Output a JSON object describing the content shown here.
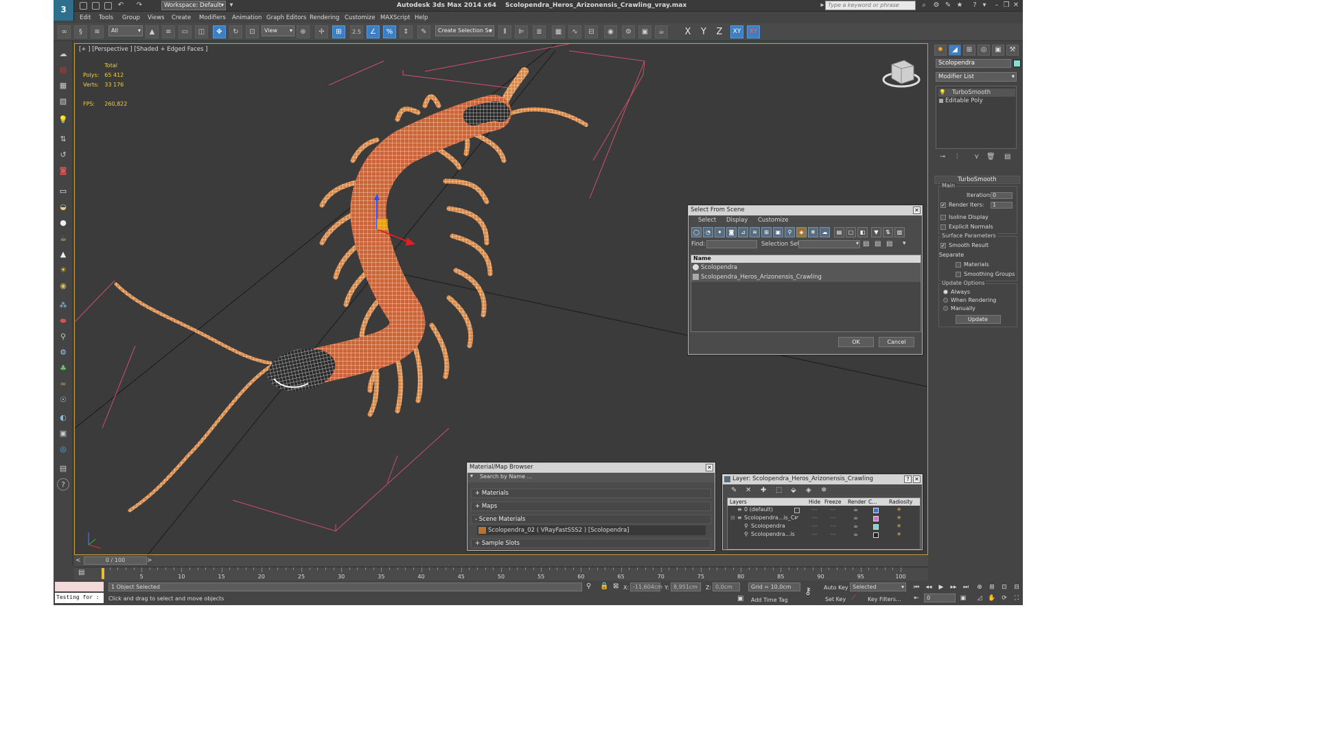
{
  "window": {
    "app_title": "Autodesk 3ds Max  2014 x64",
    "file_name": "Scolopendra_Heros_Arizonensis_Crawling_vray.max",
    "workspace": "Workspace: Default",
    "search_placeholder": "Type a keyword or phrase"
  },
  "menu": [
    "Edit",
    "Tools",
    "Group",
    "Views",
    "Create",
    "Modifiers",
    "Animation",
    "Graph Editors",
    "Rendering",
    "Customize",
    "MAXScript",
    "Help"
  ],
  "toolbar": {
    "filter_select": "All",
    "ref_coord": "View",
    "snap_value": "2.5",
    "selection_set_placeholder": "Create Selection Se",
    "axes": [
      "X",
      "Y",
      "Z",
      "XY"
    ],
    "axis_extra": "XY"
  },
  "viewport": {
    "label": "[+ ] [Perspective ] [Shaded + Edged Faces ]",
    "stats": {
      "total_label": "Total",
      "polys_label": "Polys:",
      "polys_value": "65 412",
      "verts_label": "Verts:",
      "verts_value": "33 176",
      "fps_label": "FPS:",
      "fps_value": "260,822"
    }
  },
  "command_panel": {
    "object_name": "Scolopendra",
    "object_color": "#7de3d4",
    "modifier_list": "Modifier List",
    "stack": [
      "TurboSmooth",
      "Editable Poly"
    ],
    "turbosmooth": {
      "title": "TurboSmooth",
      "main_group": "Main",
      "iterations_label": "Iterations:",
      "iterations_value": "0",
      "render_iters_label": "Render Iters:",
      "render_iters_value": "1",
      "render_iters_checked": true,
      "isoline_label": "Isoline Display",
      "explicit_normals_label": "Explicit Normals",
      "surface_group": "Surface Parameters",
      "smooth_result_label": "Smooth Result",
      "separate_label": "Separate",
      "materials_label": "Materials",
      "smoothing_groups_label": "Smoothing Groups",
      "update_group": "Update Options",
      "always_label": "Always",
      "when_rendering_label": "When Rendering",
      "manually_label": "Manually",
      "update_button": "Update"
    }
  },
  "select_from_scene": {
    "title": "Select From Scene",
    "tabs": [
      "Select",
      "Display",
      "Customize"
    ],
    "find_label": "Find:",
    "selection_set_label": "Selection Set:",
    "column_name": "Name",
    "items": [
      "Scolopendra",
      "Scolopendra_Heros_Arizonensis_Crawling"
    ],
    "ok_label": "OK",
    "cancel_label": "Cancel"
  },
  "material_browser": {
    "title": "Material/Map Browser",
    "search_placeholder": "Search by Name ...",
    "sections": [
      "+ Materials",
      "+ Maps",
      "- Scene Materials"
    ],
    "scene_material": "Scolopendra_02  ( VRayFastSSS2 ) [Scolopendra]",
    "sample_slots": "+ Sample Slots"
  },
  "layer_window": {
    "title": "Layer: Scolopendra_Heros_Arizonensis_Crawling",
    "help": "?",
    "columns": [
      "Layers",
      "Hide",
      "Freeze",
      "Render",
      "C...",
      "Radiosity"
    ],
    "rows": [
      {
        "name": "0 (default)",
        "color": "#3f6fd8"
      },
      {
        "name": "Scolopendra...is_Cr",
        "color": "#d86fd8"
      },
      {
        "name": "Scolopendra",
        "color": "#6fd8d0"
      },
      {
        "name": "Scolopendra...is",
        "color": "#222222"
      }
    ]
  },
  "timeline": {
    "frame_display": "0 / 100",
    "ticks": [
      "0",
      "5",
      "10",
      "15",
      "20",
      "25",
      "30",
      "35",
      "40",
      "45",
      "50",
      "55",
      "60",
      "65",
      "70",
      "75",
      "80",
      "85",
      "90",
      "95",
      "100"
    ]
  },
  "status": {
    "script_listener": "Testing for :",
    "selected_text": "1 Object Selected",
    "prompt_text": "Click and drag to select and move objects",
    "x_label": "X:",
    "x_value": "-11,604cm",
    "y_label": "Y:",
    "y_value": "8,951cm",
    "z_label": "Z:",
    "z_value": "0,0cm",
    "grid_text": "Grid = 10,0cm",
    "add_time_tag": "Add Time Tag",
    "auto_key": "Auto Key",
    "set_key": "Set Key",
    "selected_dropdown": "Selected",
    "key_filters": "Key Filters...",
    "frame_value": "0"
  }
}
